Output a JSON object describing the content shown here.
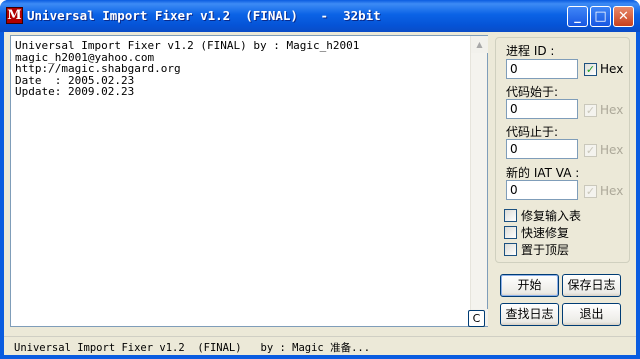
{
  "window": {
    "icon_letter": "M",
    "title": "Universal Import Fixer v1.2  (FINAL)   -  32bit",
    "min_glyph": "_",
    "max_glyph": "□",
    "close_glyph": "✕"
  },
  "log": {
    "text": "Universal Import Fixer v1.2 (FINAL) by : Magic_h2001\nmagic_h2001@yahoo.com\nhttp://magic.shabgard.org\nDate  : 2005.02.23\nUpdate: 2009.02.23",
    "clear_label": "C",
    "scroll_up_glyph": "▲",
    "scroll_down_glyph": "▼"
  },
  "panel": {
    "pid_label": "进程 ID :",
    "pid_value": "0",
    "pid_hex_label": "Hex",
    "pid_hex_checked": true,
    "code_start_label": "代码始于:",
    "code_start_value": "0",
    "code_start_hex_label": "Hex",
    "code_end_label": "代码止于:",
    "code_end_value": "0",
    "code_end_hex_label": "Hex",
    "iat_label": "新的 IAT VA :",
    "iat_value": "0",
    "iat_hex_label": "Hex",
    "options": [
      {
        "label": "修复输入表",
        "checked": false
      },
      {
        "label": "快速修复",
        "checked": false
      },
      {
        "label": "置于顶层",
        "checked": false
      }
    ],
    "check_glyph": "✓"
  },
  "buttons": {
    "start": "开始",
    "save_log": "保存日志",
    "find_log": "查找日志",
    "exit": "退出"
  },
  "status": {
    "text": "Universal Import Fixer v1.2  (FINAL)   by : Magic 准备..."
  },
  "colors": {
    "titlebar": "#0a5ce0",
    "client": "#ece9d8",
    "check": "#21a121"
  }
}
